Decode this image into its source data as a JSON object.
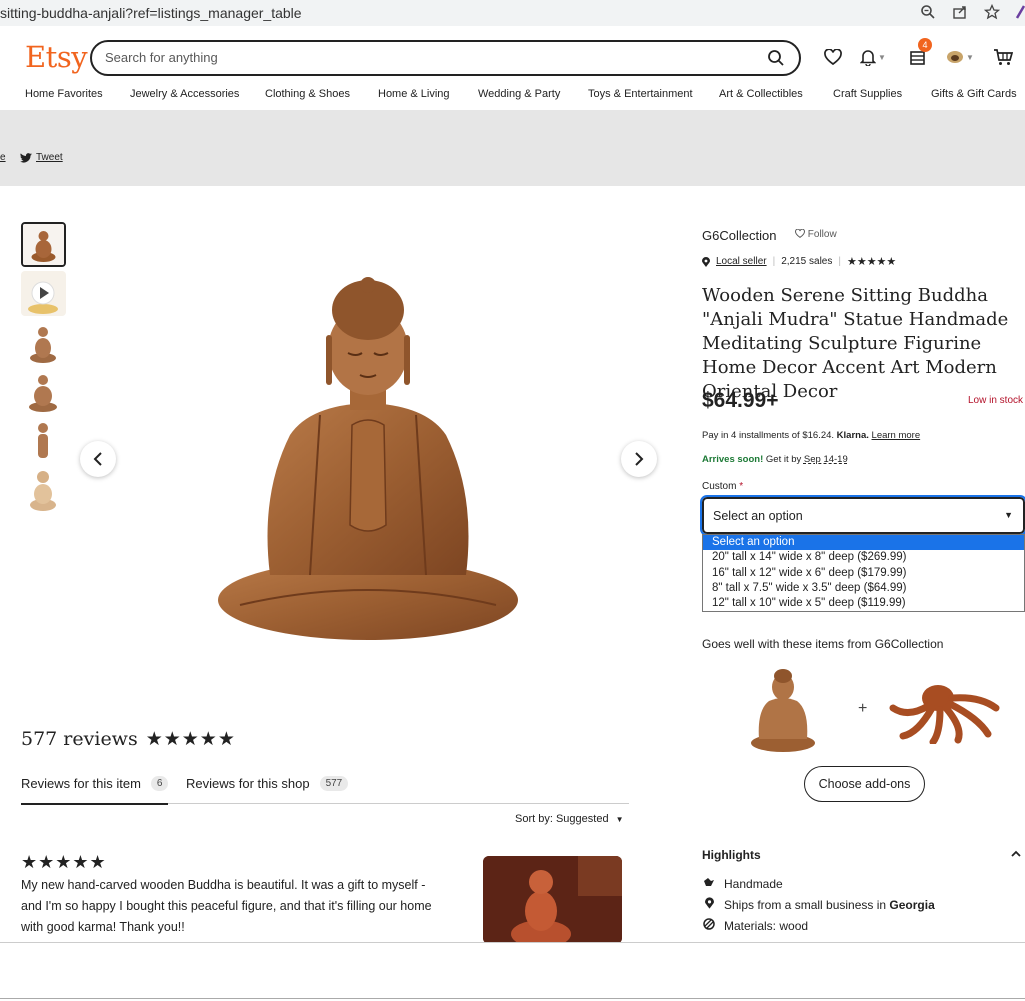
{
  "browser": {
    "url": "sitting-buddha-anjali?ref=listings_manager_table",
    "icons": [
      "zoom-icon",
      "share-icon",
      "bookmark-star-icon"
    ]
  },
  "header": {
    "logo": "Etsy",
    "search_placeholder": "Search for anything",
    "cart_badge": "4"
  },
  "categories": [
    "Home Favorites",
    "Jewelry & Accessories",
    "Clothing & Shoes",
    "Home & Living",
    "Wedding & Party",
    "Toys & Entertainment",
    "Art & Collectibles",
    "Craft Supplies",
    "Gifts & Gift Cards"
  ],
  "banner": {
    "share_fragment": "e",
    "tweet": "Tweet"
  },
  "shop": {
    "name": "G6Collection",
    "follow": "Follow",
    "local_seller": "Local seller",
    "sales": "2,215 sales",
    "rating_stars": "★★★★★"
  },
  "product": {
    "title": "Wooden Serene Sitting Buddha \"Anjali Mudra\" Statue Handmade Meditating Sculpture Figurine Home Decor Accent Art Modern Oriental Decor",
    "price": "$64.99+",
    "stock": "Low in stock",
    "klarna_prefix": "Pay in 4 installments of $16.24.",
    "klarna_brand": "Klarna.",
    "klarna_link": "Learn more",
    "arrives_soon": "Arrives soon!",
    "arrives_text": "Get it by",
    "arrives_date": "Sep 14-19"
  },
  "custom": {
    "label": "Custom",
    "required_mark": "*",
    "selected": "Select an option",
    "options": [
      "Select an option",
      "20\" tall x 14\" wide x 8\" deep ($269.99)",
      "16\" tall x 12\" wide x 6\" deep ($179.99)",
      "8\" tall x 7.5\" wide x 3.5\" deep ($64.99)",
      "12\" tall x 10\" wide x 5\" deep ($119.99)"
    ]
  },
  "addons": {
    "heading": "Goes well with these items from G6Collection",
    "plus": "+",
    "button": "Choose add-ons"
  },
  "highlights": {
    "heading": "Highlights",
    "items": [
      {
        "icon": "handmade-icon",
        "text": "Handmade"
      },
      {
        "icon": "location-pin-icon",
        "text": "Ships from a small business in",
        "bold": "Georgia"
      },
      {
        "icon": "materials-icon",
        "text": "Materials: wood"
      }
    ]
  },
  "reviews": {
    "title": "577 reviews",
    "stars": "★★★★★",
    "tab_item": "Reviews for this item",
    "tab_item_count": "6",
    "tab_shop": "Reviews for this shop",
    "tab_shop_count": "577",
    "sort": "Sort by: Suggested",
    "review_stars": "★★★★★",
    "review_text": "My new hand-carved wooden Buddha is beautiful. It was a gift to myself - and I'm so happy I bought this peaceful figure, and that it's filling our home with good karma! Thank you!!"
  },
  "colors": {
    "brand": "#f1641e",
    "select_highlight": "#1a73e8",
    "stock_red": "#b3122a",
    "arrives_green": "#1d7a36"
  }
}
